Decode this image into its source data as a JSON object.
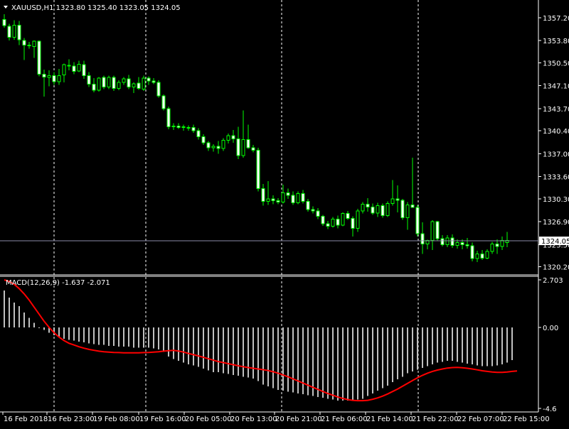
{
  "chart_data": {
    "type": "candlestick",
    "symbol_label": "XAUUSD,H1",
    "ohlc_label": "1323.80 1325.40 1323.05 1324.05",
    "current_price": 1324.05,
    "current_price_label": "1324.05",
    "price_ylim": [
      1319.0,
      1359.4
    ],
    "price_ticks": [
      "1357.20",
      "1353.80",
      "1350.50",
      "1347.10",
      "1343.70",
      "1340.40",
      "1337.00",
      "1333.60",
      "1330.30",
      "1326.90",
      "1323.50",
      "1320.20"
    ],
    "x_labels": [
      "16 Feb 2018",
      "16 Feb 23:00",
      "19 Feb 08:00",
      "19 Feb 16:00",
      "20 Feb 05:00",
      "20 Feb 13:00",
      "20 Feb 21:00",
      "21 Feb 06:00",
      "21 Feb 14:00",
      "21 Feb 22:00",
      "22 Feb 07:00",
      "22 Feb 15:00"
    ],
    "grid_after_label_index": [
      1,
      3,
      6,
      9
    ],
    "candles": [
      [
        1356.9,
        1357.7,
        1355.7,
        1356.0
      ],
      [
        1355.9,
        1356.3,
        1353.8,
        1354.3
      ],
      [
        1354.3,
        1356.8,
        1353.9,
        1356.1
      ],
      [
        1356.1,
        1356.7,
        1353.1,
        1353.9
      ],
      [
        1353.8,
        1354.2,
        1350.9,
        1353.1
      ],
      [
        1353.1,
        1353.6,
        1352.6,
        1353.0
      ],
      [
        1352.9,
        1353.8,
        1351.2,
        1353.7
      ],
      [
        1353.7,
        1353.8,
        1348.5,
        1348.8
      ],
      [
        1348.8,
        1349.5,
        1345.5,
        1348.4
      ],
      [
        1348.3,
        1349.4,
        1347.0,
        1348.6
      ],
      [
        1348.6,
        1349.1,
        1347.2,
        1347.7
      ],
      [
        1347.7,
        1349.6,
        1347.2,
        1348.6
      ],
      [
        1348.7,
        1350.4,
        1347.6,
        1350.2
      ],
      [
        1350.1,
        1351.0,
        1349.4,
        1350.0
      ],
      [
        1350.0,
        1350.6,
        1348.8,
        1349.2
      ],
      [
        1349.3,
        1350.8,
        1349.1,
        1350.3
      ],
      [
        1350.2,
        1350.8,
        1348.1,
        1348.6
      ],
      [
        1348.6,
        1349.1,
        1346.9,
        1347.3
      ],
      [
        1347.3,
        1348.2,
        1346.1,
        1346.4
      ],
      [
        1346.4,
        1348.4,
        1346.2,
        1348.2
      ],
      [
        1348.3,
        1348.6,
        1346.6,
        1346.9
      ],
      [
        1346.9,
        1348.6,
        1346.6,
        1348.3
      ],
      [
        1348.3,
        1348.6,
        1346.3,
        1346.7
      ],
      [
        1346.7,
        1347.9,
        1346.4,
        1347.6
      ],
      [
        1347.6,
        1348.4,
        1347.2,
        1348.1
      ],
      [
        1348.1,
        1348.7,
        1346.6,
        1346.9
      ],
      [
        1346.9,
        1347.6,
        1346.0,
        1347.4
      ],
      [
        1347.5,
        1348.4,
        1346.5,
        1346.7
      ],
      [
        1346.6,
        1348.6,
        1346.3,
        1348.2
      ],
      [
        1348.2,
        1348.5,
        1347.2,
        1347.8
      ],
      [
        1347.8,
        1348.2,
        1347.3,
        1347.6
      ],
      [
        1347.6,
        1347.9,
        1345.3,
        1345.6
      ],
      [
        1345.6,
        1345.8,
        1343.4,
        1343.7
      ],
      [
        1343.7,
        1344.0,
        1340.6,
        1341.0
      ],
      [
        1341.0,
        1341.5,
        1340.5,
        1341.1
      ],
      [
        1341.1,
        1341.5,
        1340.7,
        1340.9
      ],
      [
        1341.0,
        1341.3,
        1340.4,
        1340.9
      ],
      [
        1340.9,
        1341.2,
        1340.4,
        1340.9
      ],
      [
        1340.9,
        1341.3,
        1340.1,
        1340.4
      ],
      [
        1340.4,
        1340.8,
        1339.1,
        1339.5
      ],
      [
        1339.5,
        1339.9,
        1338.3,
        1338.6
      ],
      [
        1338.6,
        1338.9,
        1337.4,
        1337.9
      ],
      [
        1337.9,
        1338.4,
        1337.3,
        1338.1
      ],
      [
        1338.1,
        1338.9,
        1337.0,
        1337.8
      ],
      [
        1337.8,
        1339.3,
        1337.4,
        1339.0
      ],
      [
        1339.0,
        1340.0,
        1338.5,
        1339.7
      ],
      [
        1339.7,
        1340.5,
        1338.6,
        1339.2
      ],
      [
        1339.2,
        1341.0,
        1336.2,
        1336.7
      ],
      [
        1336.7,
        1343.4,
        1336.4,
        1339.1
      ],
      [
        1339.1,
        1341.3,
        1337.7,
        1337.9
      ],
      [
        1337.9,
        1338.3,
        1337.2,
        1337.5
      ],
      [
        1337.5,
        1337.9,
        1331.4,
        1331.8
      ],
      [
        1331.8,
        1332.5,
        1329.3,
        1329.9
      ],
      [
        1329.9,
        1332.9,
        1329.4,
        1330.3
      ],
      [
        1330.3,
        1330.8,
        1329.5,
        1330.0
      ],
      [
        1330.0,
        1330.4,
        1329.5,
        1329.8
      ],
      [
        1329.8,
        1332.4,
        1329.6,
        1331.2
      ],
      [
        1331.2,
        1331.8,
        1330.3,
        1330.8
      ],
      [
        1330.8,
        1331.4,
        1329.4,
        1329.7
      ],
      [
        1329.7,
        1331.4,
        1329.5,
        1331.1
      ],
      [
        1331.1,
        1331.6,
        1329.6,
        1329.9
      ],
      [
        1329.9,
        1330.3,
        1328.4,
        1328.7
      ],
      [
        1328.7,
        1329.2,
        1328.1,
        1328.5
      ],
      [
        1328.5,
        1328.9,
        1327.3,
        1327.7
      ],
      [
        1327.7,
        1327.9,
        1326.3,
        1326.6
      ],
      [
        1326.6,
        1327.0,
        1325.8,
        1326.2
      ],
      [
        1326.2,
        1327.6,
        1326.0,
        1327.3
      ],
      [
        1327.3,
        1327.8,
        1325.9,
        1326.4
      ],
      [
        1326.4,
        1328.3,
        1326.2,
        1328.1
      ],
      [
        1328.1,
        1328.5,
        1327.2,
        1327.4
      ],
      [
        1327.4,
        1327.7,
        1324.7,
        1325.9
      ],
      [
        1325.9,
        1328.8,
        1325.4,
        1328.5
      ],
      [
        1328.5,
        1329.8,
        1328.1,
        1329.5
      ],
      [
        1329.5,
        1330.4,
        1328.4,
        1329.1
      ],
      [
        1329.1,
        1329.6,
        1327.9,
        1328.2
      ],
      [
        1328.2,
        1329.7,
        1327.6,
        1329.3
      ],
      [
        1329.3,
        1329.6,
        1327.5,
        1327.8
      ],
      [
        1327.8,
        1329.9,
        1327.6,
        1329.6
      ],
      [
        1329.6,
        1333.1,
        1329.3,
        1330.3
      ],
      [
        1330.3,
        1332.3,
        1328.3,
        1330.1
      ],
      [
        1330.1,
        1330.3,
        1327.2,
        1327.5
      ],
      [
        1327.5,
        1329.8,
        1325.7,
        1329.4
      ],
      [
        1329.4,
        1336.4,
        1329.1,
        1329.0
      ],
      [
        1329.0,
        1329.4,
        1324.7,
        1325.1
      ],
      [
        1325.1,
        1326.8,
        1322.1,
        1323.6
      ],
      [
        1323.6,
        1324.2,
        1322.8,
        1324.1
      ],
      [
        1324.1,
        1327.1,
        1322.7,
        1326.9
      ],
      [
        1326.9,
        1327.0,
        1324.0,
        1324.4
      ],
      [
        1324.4,
        1324.9,
        1323.2,
        1323.5
      ],
      [
        1323.5,
        1324.9,
        1323.1,
        1324.5
      ],
      [
        1324.5,
        1325.0,
        1323.0,
        1323.4
      ],
      [
        1323.4,
        1324.3,
        1322.9,
        1323.8
      ],
      [
        1323.8,
        1324.3,
        1322.8,
        1323.5
      ],
      [
        1323.5,
        1324.5,
        1322.9,
        1323.3
      ],
      [
        1323.3,
        1323.8,
        1321.0,
        1321.4
      ],
      [
        1321.4,
        1322.6,
        1320.9,
        1322.1
      ],
      [
        1322.1,
        1322.7,
        1321.2,
        1321.5
      ],
      [
        1321.5,
        1322.8,
        1321.3,
        1322.5
      ],
      [
        1322.5,
        1323.9,
        1322.1,
        1323.6
      ],
      [
        1323.6,
        1324.3,
        1322.1,
        1323.2
      ],
      [
        1323.2,
        1324.7,
        1322.7,
        1324.1
      ],
      [
        1323.8,
        1325.4,
        1323.1,
        1324.1
      ]
    ],
    "macd": {
      "label": "MACD(12,26,9) -1.637 -2.071",
      "ylim": [
        -4.8,
        2.9
      ],
      "ticks": [
        2.703,
        0.0,
        -4.6
      ],
      "tick_labels": [
        "2.703",
        "0.00",
        "-4.6"
      ],
      "main": [
        2.1,
        1.7,
        1.4,
        1.2,
        0.85,
        0.55,
        0.25,
        0.0,
        -0.15,
        -0.3,
        -0.45,
        -0.55,
        -0.65,
        -0.7,
        -0.75,
        -0.8,
        -0.85,
        -0.9,
        -0.95,
        -1.0,
        -1.0,
        -1.05,
        -1.05,
        -1.1,
        -1.1,
        -1.1,
        -1.15,
        -1.15,
        -1.15,
        -1.15,
        -1.2,
        -1.25,
        -1.4,
        -1.65,
        -1.8,
        -1.9,
        -2.0,
        -2.1,
        -2.15,
        -2.25,
        -2.35,
        -2.45,
        -2.55,
        -2.55,
        -2.6,
        -2.65,
        -2.7,
        -2.75,
        -2.8,
        -2.85,
        -2.9,
        -3.05,
        -3.25,
        -3.35,
        -3.45,
        -3.55,
        -3.6,
        -3.65,
        -3.7,
        -3.75,
        -3.8,
        -3.85,
        -3.9,
        -3.95,
        -4.0,
        -4.05,
        -4.1,
        -4.15,
        -4.15,
        -4.15,
        -4.15,
        -4.1,
        -4.05,
        -3.9,
        -3.75,
        -3.6,
        -3.45,
        -3.3,
        -3.1,
        -2.95,
        -2.8,
        -2.6,
        -2.5,
        -2.4,
        -2.3,
        -2.2,
        -2.1,
        -2.0,
        -1.95,
        -1.9,
        -1.9,
        -1.95,
        -2.0,
        -2.05,
        -2.1,
        -2.15,
        -2.2,
        -2.2,
        -2.2,
        -2.15,
        -2.1,
        -2.0,
        -1.85
      ],
      "signal": [
        2.7,
        2.6,
        2.45,
        2.2,
        1.9,
        1.55,
        1.15,
        0.75,
        0.35,
        0.0,
        -0.3,
        -0.55,
        -0.75,
        -0.9,
        -1.0,
        -1.1,
        -1.18,
        -1.25,
        -1.3,
        -1.35,
        -1.38,
        -1.4,
        -1.42,
        -1.43,
        -1.44,
        -1.44,
        -1.44,
        -1.44,
        -1.43,
        -1.42,
        -1.4,
        -1.38,
        -1.35,
        -1.32,
        -1.3,
        -1.34,
        -1.4,
        -1.48,
        -1.55,
        -1.62,
        -1.7,
        -1.78,
        -1.86,
        -1.94,
        -2.0,
        -2.06,
        -2.12,
        -2.18,
        -2.23,
        -2.28,
        -2.32,
        -2.36,
        -2.4,
        -2.45,
        -2.52,
        -2.6,
        -2.7,
        -2.8,
        -2.92,
        -3.04,
        -3.16,
        -3.28,
        -3.4,
        -3.52,
        -3.64,
        -3.75,
        -3.85,
        -3.95,
        -4.03,
        -4.1,
        -4.14,
        -4.16,
        -4.16,
        -4.14,
        -4.08,
        -4.0,
        -3.9,
        -3.78,
        -3.64,
        -3.5,
        -3.34,
        -3.18,
        -3.02,
        -2.86,
        -2.72,
        -2.6,
        -2.5,
        -2.42,
        -2.36,
        -2.31,
        -2.28,
        -2.27,
        -2.29,
        -2.32,
        -2.36,
        -2.41,
        -2.46,
        -2.5,
        -2.53,
        -2.55,
        -2.55,
        -2.53,
        -2.5,
        -2.47
      ]
    }
  }
}
